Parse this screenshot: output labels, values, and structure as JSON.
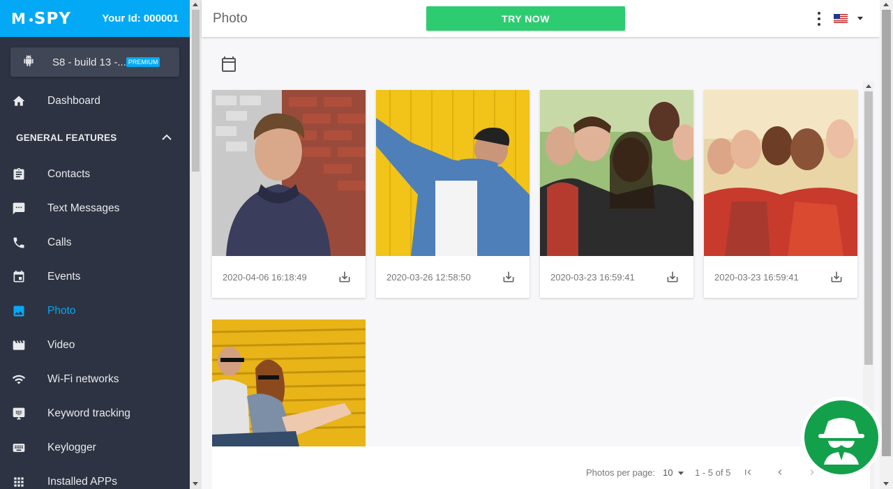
{
  "sidebar": {
    "logo_text": "SPY",
    "user_id": "Your Id: 000001",
    "device": {
      "name": "S8 - build 13 -...",
      "badge": "PREMIUM",
      "icon": "android-icon"
    },
    "items": [
      {
        "label": "Dashboard",
        "icon": "home-icon"
      },
      {
        "label": "Contacts",
        "icon": "clipboard-icon"
      },
      {
        "label": "Text Messages",
        "icon": "message-icon"
      },
      {
        "label": "Calls",
        "icon": "phone-icon"
      },
      {
        "label": "Events",
        "icon": "calendar-icon"
      },
      {
        "label": "Photo",
        "icon": "image-icon"
      },
      {
        "label": "Video",
        "icon": "movie-icon"
      },
      {
        "label": "Wi-Fi networks",
        "icon": "wifi-icon"
      },
      {
        "label": "Keyword tracking",
        "icon": "keyboard-monitor-icon"
      },
      {
        "label": "Keylogger",
        "icon": "keyboard-icon"
      },
      {
        "label": "Installed APPs",
        "icon": "apps-grid-icon"
      }
    ],
    "section_title": "GENERAL FEATURES",
    "active_item": "Photo"
  },
  "header": {
    "title": "Photo",
    "try_now": "TRY NOW",
    "language_flag": "us-flag-icon"
  },
  "photos": [
    {
      "timestamp": "2020-04-06 16:18:49"
    },
    {
      "timestamp": "2020-03-26 12:58:50"
    },
    {
      "timestamp": "2020-03-23 16:59:41"
    },
    {
      "timestamp": "2020-03-23 16:59:41"
    }
  ],
  "pagination": {
    "per_page_label": "Photos per page:",
    "per_page_value": "10",
    "range": "1 - 5 of 5"
  },
  "colors": {
    "brand": "#03a9f4",
    "sidebar_bg": "#2d3342",
    "try_now": "#2ecc71",
    "spy_badge": "#13a04a"
  }
}
